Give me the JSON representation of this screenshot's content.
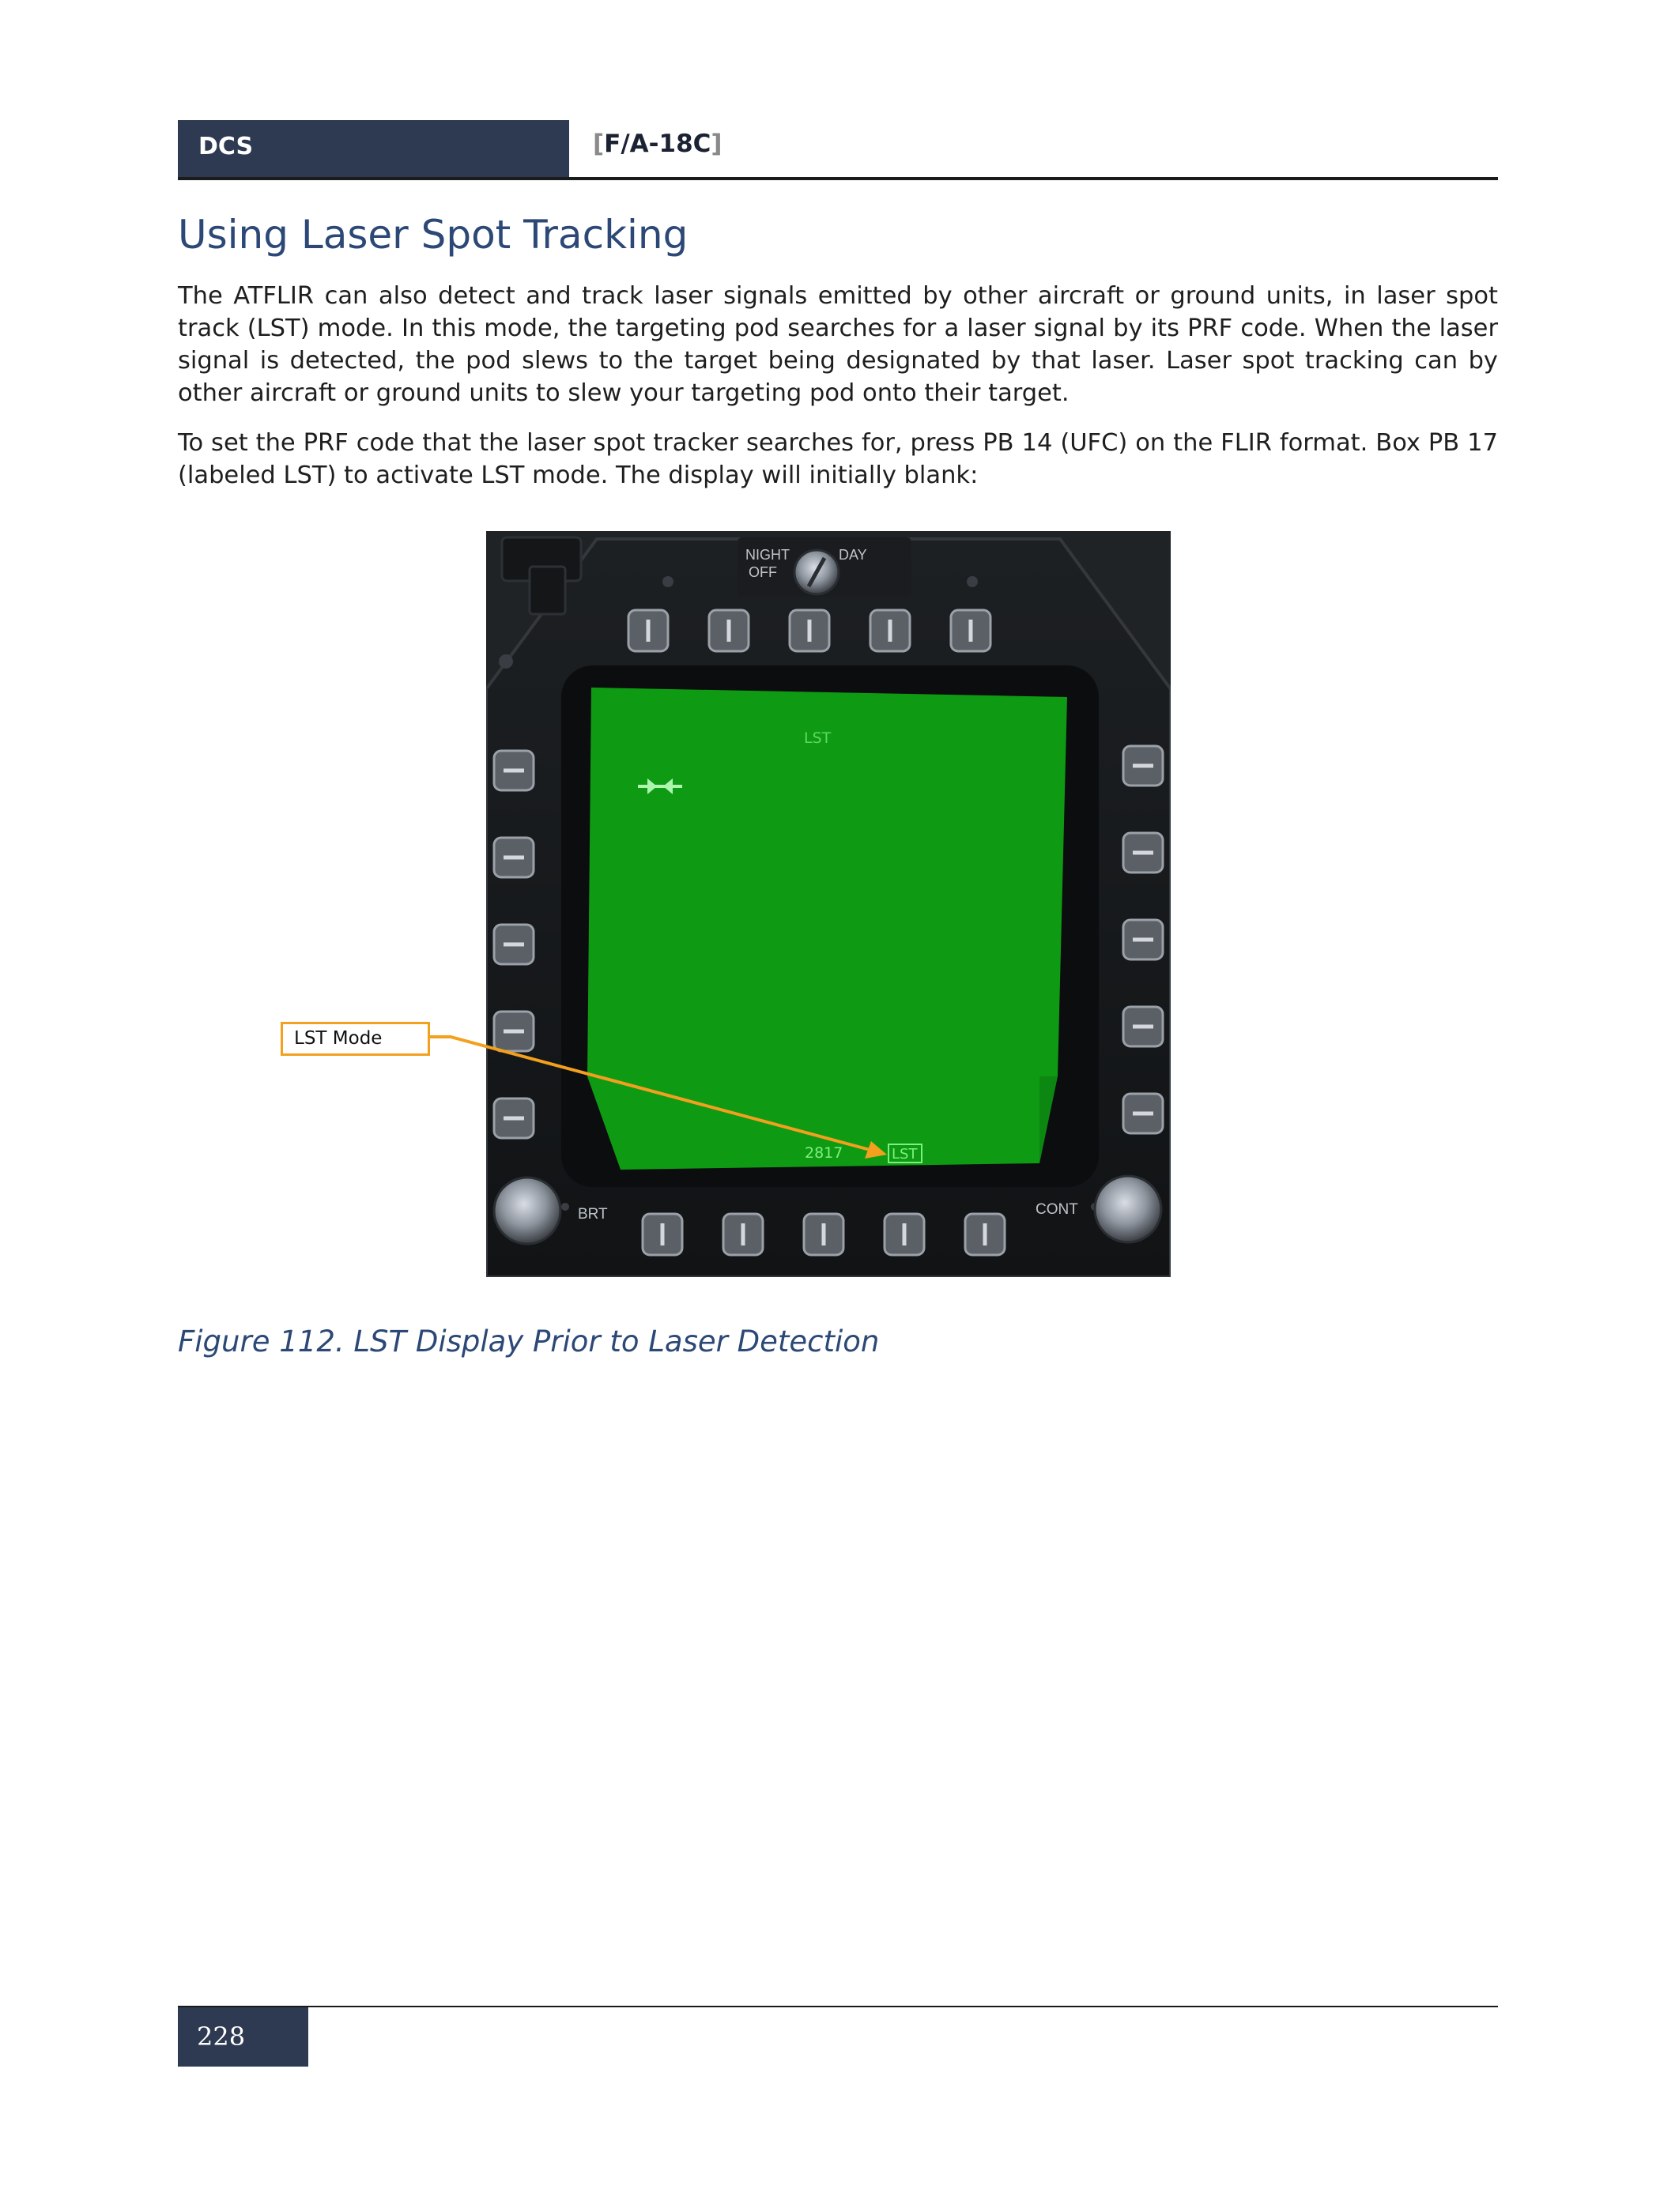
{
  "header": {
    "left": "DCS",
    "right_open": "[",
    "right_text": "F/A-18C",
    "right_close": "]"
  },
  "section_title": "Using Laser Spot Tracking",
  "paragraphs": [
    "The ATFLIR can also detect and track laser signals emitted by other aircraft or ground units, in laser spot track (LST) mode. In this mode, the targeting pod searches for a laser signal by its PRF code. When the laser signal is detected, the pod slews to the target being designated by that laser. Laser spot tracking can by other aircraft or ground units to slew your targeting pod onto their target.",
    "To set the PRF code that the laser spot tracker searches for, press PB 14 (UFC) on the FLIR format. Box PB 17 (labeled LST) to activate LST mode. The display will initially blank:"
  ],
  "figure": {
    "switch_labels": {
      "night": "NIGHT",
      "day": "DAY",
      "off": "OFF"
    },
    "knob_labels": {
      "brt": "BRT",
      "cont": "CONT"
    },
    "screen": {
      "top_label": "LST",
      "prf_code": "2817",
      "boxed_label": "LST",
      "color": "#0f9a14"
    },
    "callout_label": "LST Mode",
    "callout_color": "#f2a01e"
  },
  "caption": "Figure 112. LST Display Prior to Laser Detection",
  "footer": {
    "page_number": "228"
  }
}
